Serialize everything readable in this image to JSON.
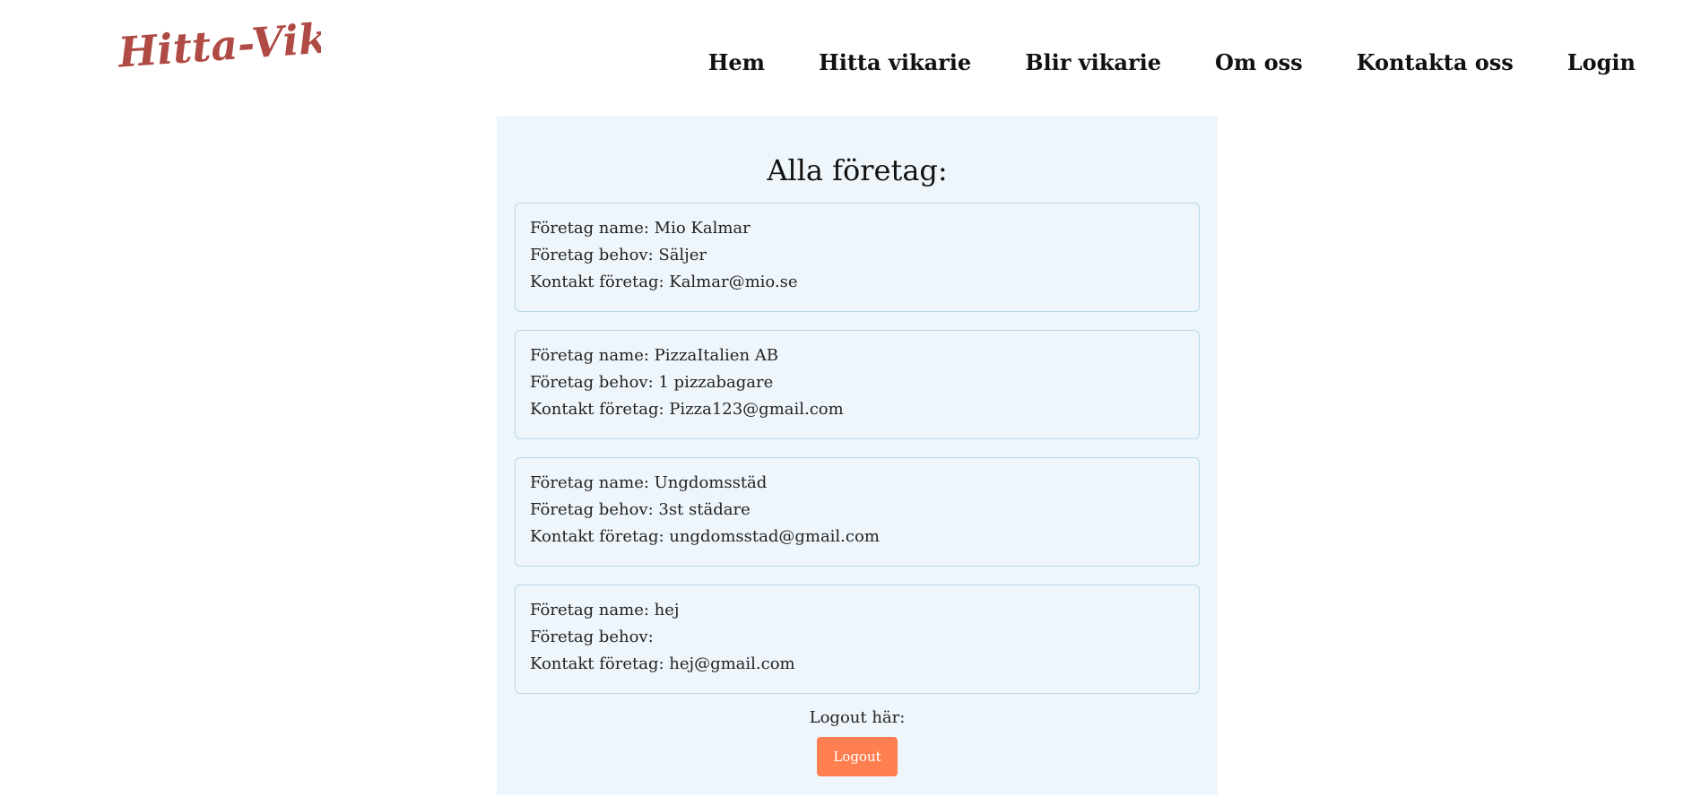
{
  "brand": {
    "logo_text": "Hitta-Vikarie",
    "logo_color": "#b04a44"
  },
  "nav": {
    "items": [
      {
        "label": "Hem"
      },
      {
        "label": "Hitta vikarie"
      },
      {
        "label": "Blir vikarie"
      },
      {
        "label": "Om oss"
      },
      {
        "label": "Kontakta oss"
      },
      {
        "label": "Login"
      }
    ]
  },
  "main": {
    "title": "Alla företag:",
    "companies": [
      {
        "name_line": "Företag name: Mio Kalmar",
        "need_line": "Företag behov: Säljer",
        "contact_line": "Kontakt företag: Kalmar@mio.se"
      },
      {
        "name_line": "Företag name: PizzaItalien AB",
        "need_line": "Företag behov: 1 pizzabagare",
        "contact_line": "Kontakt företag: Pizza123@gmail.com"
      },
      {
        "name_line": "Företag name: Ungdomsstäd",
        "need_line": "Företag behov: 3st städare",
        "contact_line": "Kontakt företag: ungdomsstad@gmail.com"
      },
      {
        "name_line": "Företag name: hej",
        "need_line": "Företag behov:",
        "contact_line": "Kontakt företag: hej@gmail.com"
      }
    ],
    "logout_label": "Logout här:",
    "logout_button": "Logout"
  },
  "colors": {
    "panel_bg": "#eef6fc",
    "card_border": "#b9d8ea",
    "logout_button_bg": "#ff7f50"
  }
}
